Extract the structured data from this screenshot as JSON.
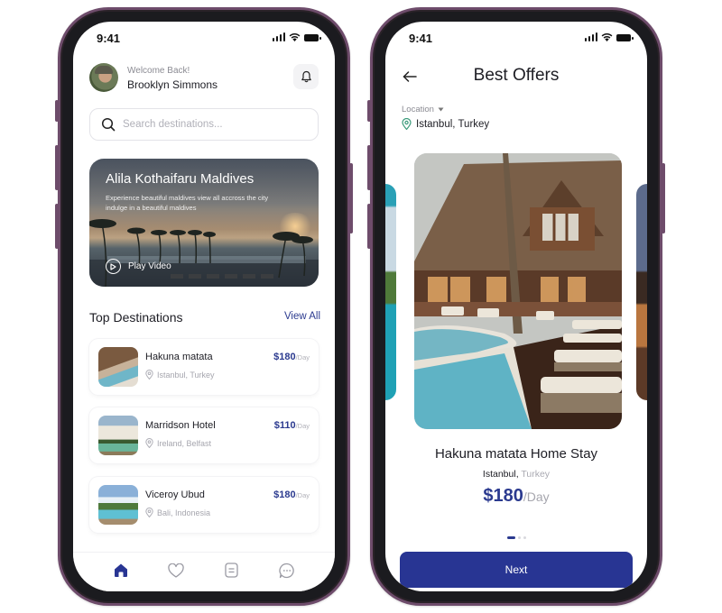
{
  "status_bar": {
    "time": "9:41"
  },
  "home": {
    "welcome": "Welcome Back!",
    "user_name": "Brooklyn Simmons",
    "search": {
      "placeholder": "Search destinations...",
      "value": ""
    },
    "hero": {
      "title": "Alila Kothaifaru Maldives",
      "description": "Experience beautiful maldives view all accross the city indulge in a beautiful maldives",
      "play_label": "Play Video"
    },
    "section_title": "Top Destinations",
    "view_all": "View All",
    "destinations": [
      {
        "name": "Hakuna matata",
        "location": "Istanbul, Turkey",
        "price": "$180",
        "unit": "/Day"
      },
      {
        "name": "Marridson Hotel",
        "location": "Ireland, Belfast",
        "price": "$110",
        "unit": "/Day"
      },
      {
        "name": "Viceroy Ubud",
        "location": "Bali, Indonesia",
        "price": "$180",
        "unit": "/Day"
      }
    ],
    "tabs": [
      {
        "icon": "home-icon",
        "active": true
      },
      {
        "icon": "heart-icon",
        "active": false
      },
      {
        "icon": "document-icon",
        "active": false
      },
      {
        "icon": "chat-icon",
        "active": false
      }
    ]
  },
  "offers": {
    "title": "Best Offers",
    "location_label": "Location",
    "location_value": "Istanbul, Turkey",
    "offer": {
      "name": "Hakuna matata Home Stay",
      "city": "Istanbul,",
      "country": "Turkey",
      "price": "$180",
      "unit": "/Day"
    },
    "carousel": {
      "total": 3,
      "active_index": 0
    },
    "next_label": "Next"
  },
  "colors": {
    "accent": "#283593",
    "price_text": "#2b3a8f",
    "phone_frame": "#6e4c6b",
    "location_pin": "#3a9a7a"
  }
}
